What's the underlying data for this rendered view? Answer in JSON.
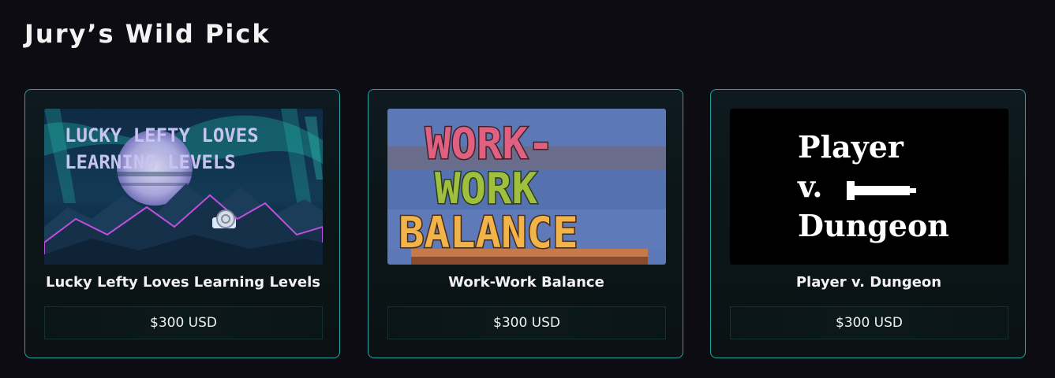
{
  "section": {
    "title": "Jury’s Wild Pick"
  },
  "cards": [
    {
      "title": "Lucky Lefty Loves Learning Levels",
      "prize": "$300 USD",
      "thumbnail_text": [
        "LUCKY LEFTY LOVES",
        "LEARNING LEVELS"
      ]
    },
    {
      "title": "Work-Work Balance",
      "prize": "$300 USD",
      "thumbnail_text": [
        "WORK-",
        "WORK",
        "BALANCE"
      ]
    },
    {
      "title": "Player v. Dungeon",
      "prize": "$300 USD",
      "thumbnail_text": [
        "Player",
        "v.",
        "Dungeon"
      ]
    }
  ],
  "colors": {
    "background": "#0c0c12",
    "card_border": "#22a6a0",
    "text": "#f2f2f2"
  }
}
